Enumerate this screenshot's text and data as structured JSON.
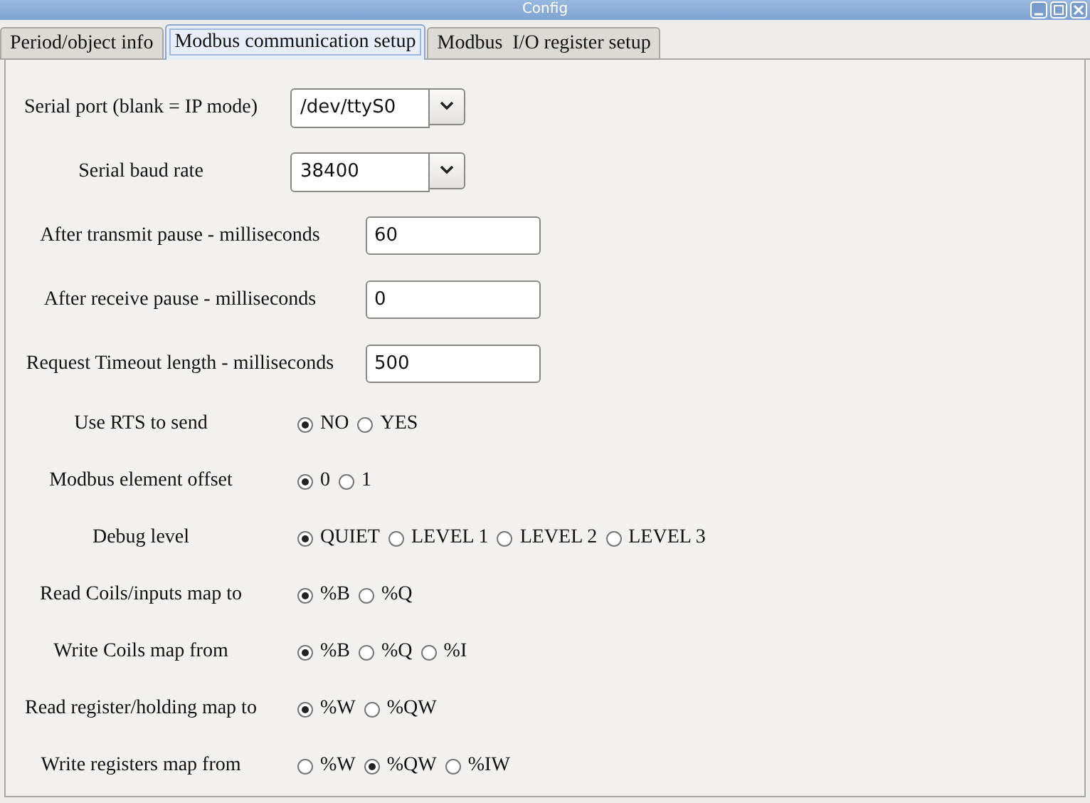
{
  "window": {
    "title": "Config"
  },
  "tabs": [
    {
      "label": "Period/object info",
      "selected": false
    },
    {
      "label": "Modbus communication setup",
      "selected": true
    },
    {
      "label": "Modbus  I/O register setup",
      "selected": false
    }
  ],
  "rows": [
    {
      "kind": "combo",
      "label": "Serial port (blank = IP mode)",
      "value": "/dev/ttyS0"
    },
    {
      "kind": "combo",
      "label": "Serial baud rate",
      "value": "38400"
    },
    {
      "kind": "field",
      "label": "After transmit pause - milliseconds",
      "value": "60"
    },
    {
      "kind": "field",
      "label": "After receive pause - milliseconds",
      "value": "0"
    },
    {
      "kind": "field",
      "label": "Request Timeout length - milliseconds",
      "value": "500"
    },
    {
      "kind": "radio",
      "label": "Use RTS to send",
      "options": [
        {
          "label": "NO",
          "selected": true
        },
        {
          "label": "YES",
          "selected": false
        }
      ]
    },
    {
      "kind": "radio",
      "label": "Modbus element offset",
      "options": [
        {
          "label": "0",
          "selected": true
        },
        {
          "label": "1",
          "selected": false
        }
      ]
    },
    {
      "kind": "radio",
      "label": "Debug level",
      "options": [
        {
          "label": "QUIET",
          "selected": true
        },
        {
          "label": "LEVEL 1",
          "selected": false
        },
        {
          "label": "LEVEL 2",
          "selected": false
        },
        {
          "label": "LEVEL 3",
          "selected": false
        }
      ]
    },
    {
      "kind": "radio",
      "label": "Read Coils/inputs map to",
      "options": [
        {
          "label": "%B",
          "selected": true
        },
        {
          "label": "%Q",
          "selected": false
        }
      ]
    },
    {
      "kind": "radio",
      "label": "Write Coils map from",
      "options": [
        {
          "label": "%B",
          "selected": true
        },
        {
          "label": "%Q",
          "selected": false
        },
        {
          "label": "%I",
          "selected": false
        }
      ]
    },
    {
      "kind": "radio",
      "label": "Read register/holding map to",
      "options": [
        {
          "label": "%W",
          "selected": true
        },
        {
          "label": "%QW",
          "selected": false
        }
      ]
    },
    {
      "kind": "radio",
      "label": "Write registers map from",
      "options": [
        {
          "label": "%W",
          "selected": false
        },
        {
          "label": "%QW",
          "selected": true
        },
        {
          "label": "%IW",
          "selected": false
        }
      ]
    }
  ]
}
